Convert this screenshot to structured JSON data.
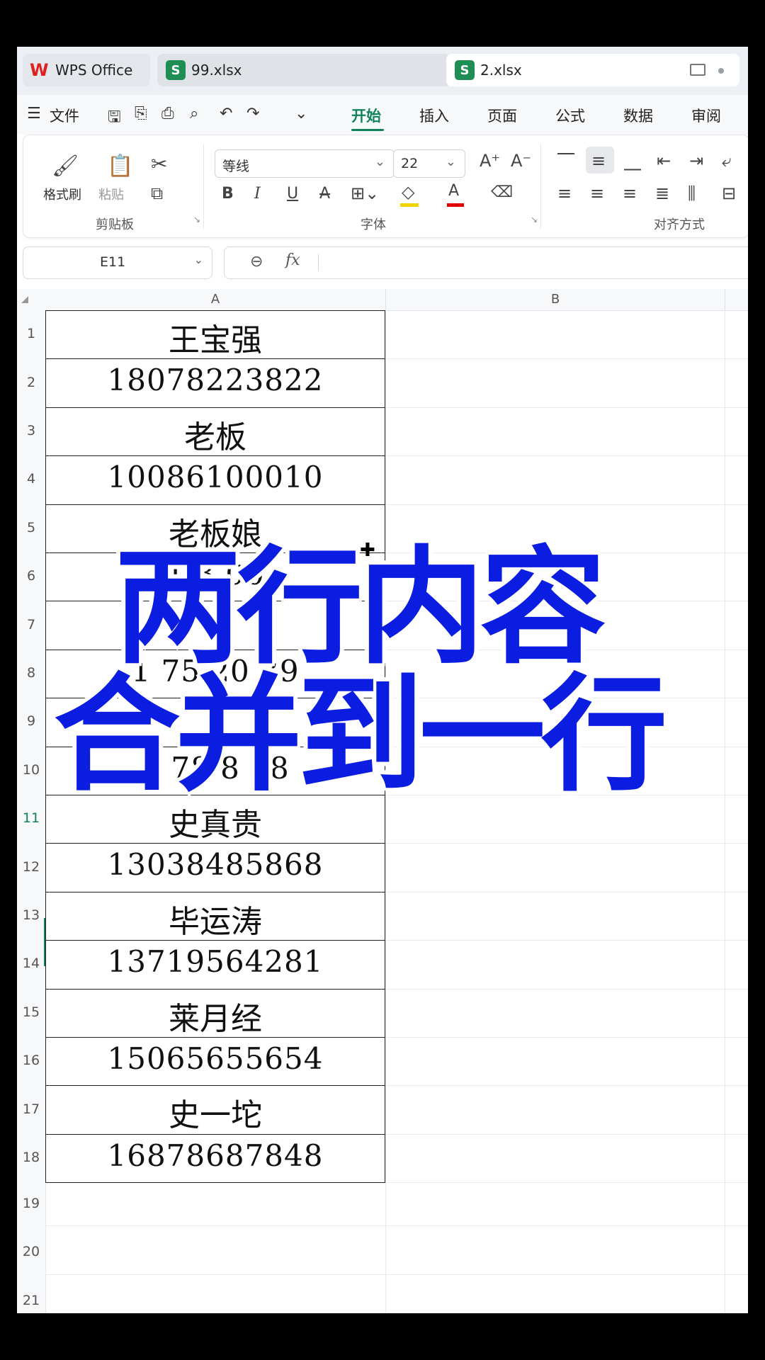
{
  "titlebar": {
    "tabs": [
      {
        "label": "WPS Office"
      },
      {
        "label": "99.xlsx"
      },
      {
        "label": "2.xlsx"
      }
    ]
  },
  "menubar": {
    "file": "文件",
    "items": [
      "开始",
      "插入",
      "页面",
      "公式",
      "数据",
      "审阅"
    ],
    "active": "开始"
  },
  "ribbon": {
    "clipboard": {
      "format_painter": "格式刷",
      "paste": "粘贴",
      "group_label": "剪贴板"
    },
    "font": {
      "font_name": "等线",
      "font_size": "22",
      "bold": "B",
      "italic": "I",
      "underline": "U",
      "strike": "A",
      "group_label": "字体"
    },
    "align": {
      "group_label": "对齐方式"
    }
  },
  "formula_bar": {
    "name_box": "E11",
    "fx": "fx"
  },
  "grid": {
    "columns": [
      "A",
      "B"
    ],
    "rows": [
      "1",
      "2",
      "3",
      "4",
      "5",
      "6",
      "7",
      "8",
      "9",
      "10",
      "11",
      "12",
      "13",
      "14",
      "15",
      "16",
      "17",
      "18",
      "19",
      "20",
      "21"
    ],
    "cells_a": [
      "王宝强",
      "18078223822",
      "老板",
      "10086100010",
      "老板娘",
      "1      3    00",
      "",
      "1  75   20  39",
      "",
      "1    78  8  38",
      "史真贵",
      "13038485868",
      "毕运涛",
      "13719564281",
      "莱月经",
      "15065655654",
      "史一坨",
      "16878687848"
    ],
    "selected_row": "11"
  },
  "overlay": {
    "line1": "两行内容",
    "line2": "合并到一行"
  },
  "colors": {
    "accent": "#10825a",
    "caption": "#0b1de0"
  }
}
